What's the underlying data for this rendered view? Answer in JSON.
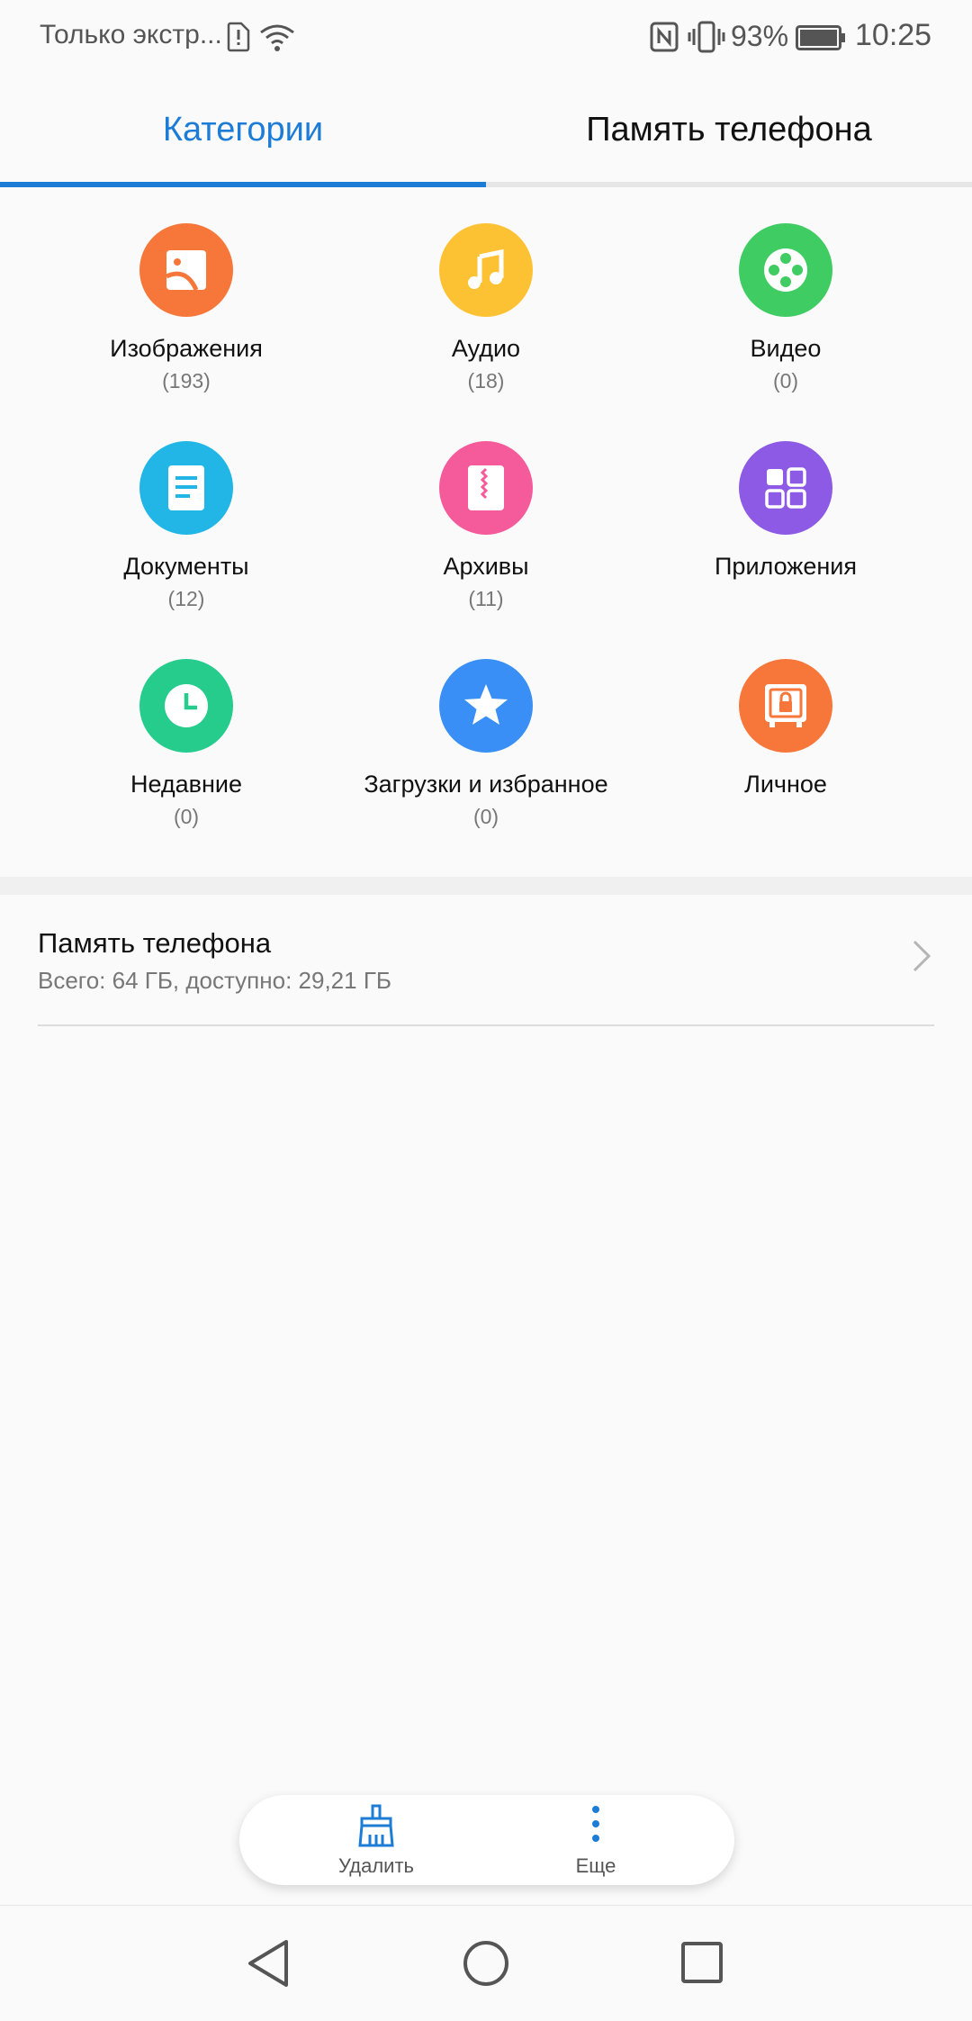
{
  "status_bar": {
    "carrier": "Только экстр...",
    "battery_percent": "93%",
    "time": "10:25"
  },
  "tabs": [
    {
      "label": "Категории",
      "active": true
    },
    {
      "label": "Память телефона",
      "active": false
    }
  ],
  "categories": [
    {
      "label": "Изображения",
      "count": "(193)",
      "icon": "image-icon",
      "color": "#f7773a"
    },
    {
      "label": "Аудио",
      "count": "(18)",
      "icon": "music-icon",
      "color": "#fdc233"
    },
    {
      "label": "Видео",
      "count": "(0)",
      "icon": "video-reel-icon",
      "color": "#3fcc62"
    },
    {
      "label": "Документы",
      "count": "(12)",
      "icon": "document-icon",
      "color": "#22b6e6"
    },
    {
      "label": "Архивы",
      "count": "(11)",
      "icon": "archive-icon",
      "color": "#f55a9a"
    },
    {
      "label": "Приложения",
      "count": "",
      "icon": "apps-grid-icon",
      "color": "#8d5ae6"
    },
    {
      "label": "Недавние",
      "count": "(0)",
      "icon": "clock-icon",
      "color": "#25cc8c"
    },
    {
      "label": "Загрузки и избранное",
      "count": "(0)",
      "icon": "star-icon",
      "color": "#3a8ff7"
    },
    {
      "label": "Личное",
      "count": "",
      "icon": "safe-icon",
      "color": "#f7773a"
    }
  ],
  "phone_memory": {
    "title": "Память телефона",
    "subtitle": "Всего: 64 ГБ, доступно: 29,21 ГБ"
  },
  "bottom_actions": {
    "delete_label": "Удалить",
    "more_label": "Еще"
  },
  "colors": {
    "accent": "#1c7cd6"
  }
}
